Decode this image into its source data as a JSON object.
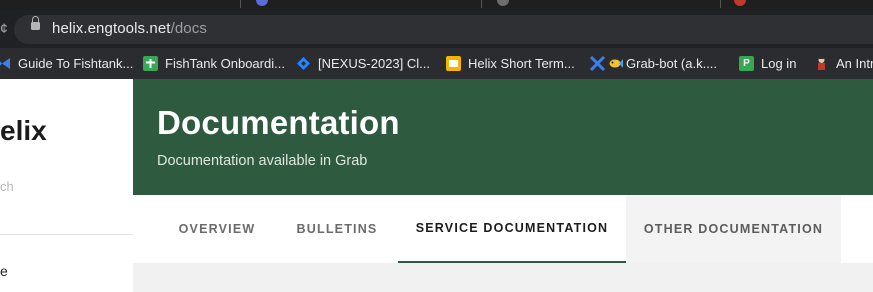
{
  "browser": {
    "url_host": "helix.engtools.net",
    "url_path": "/docs"
  },
  "bookmarks": [
    {
      "label": "Guide To Fishtank...",
      "icon": "fishtank-icon"
    },
    {
      "label": "FishTank Onboardi...",
      "icon": "cross-icon"
    },
    {
      "label": "[NEXUS-2023] Cl...",
      "icon": "jira-diamond-icon"
    },
    {
      "label": "Helix Short Term...",
      "icon": "slides-icon"
    },
    {
      "label": "Grab-bot (a.k....",
      "icon": "fish-icon"
    },
    {
      "label": "Log in",
      "icon": "p-icon"
    },
    {
      "label": "An Intr",
      "icon": "person-icon"
    }
  ],
  "sidebar": {
    "brand": "elix",
    "search_fragment": "ch",
    "item_fragment": "e"
  },
  "header": {
    "title": "Documentation",
    "subtitle": "Documentation available in Grab"
  },
  "tabs": [
    {
      "label": "OVERVIEW",
      "active": false
    },
    {
      "label": "BULLETINS",
      "active": false
    },
    {
      "label": "SERVICE DOCUMENTATION",
      "active": true
    },
    {
      "label": "OTHER DOCUMENTATION",
      "active": false
    }
  ],
  "colors": {
    "banner": "#2e5a3f",
    "accent": "#2e5a3f"
  }
}
